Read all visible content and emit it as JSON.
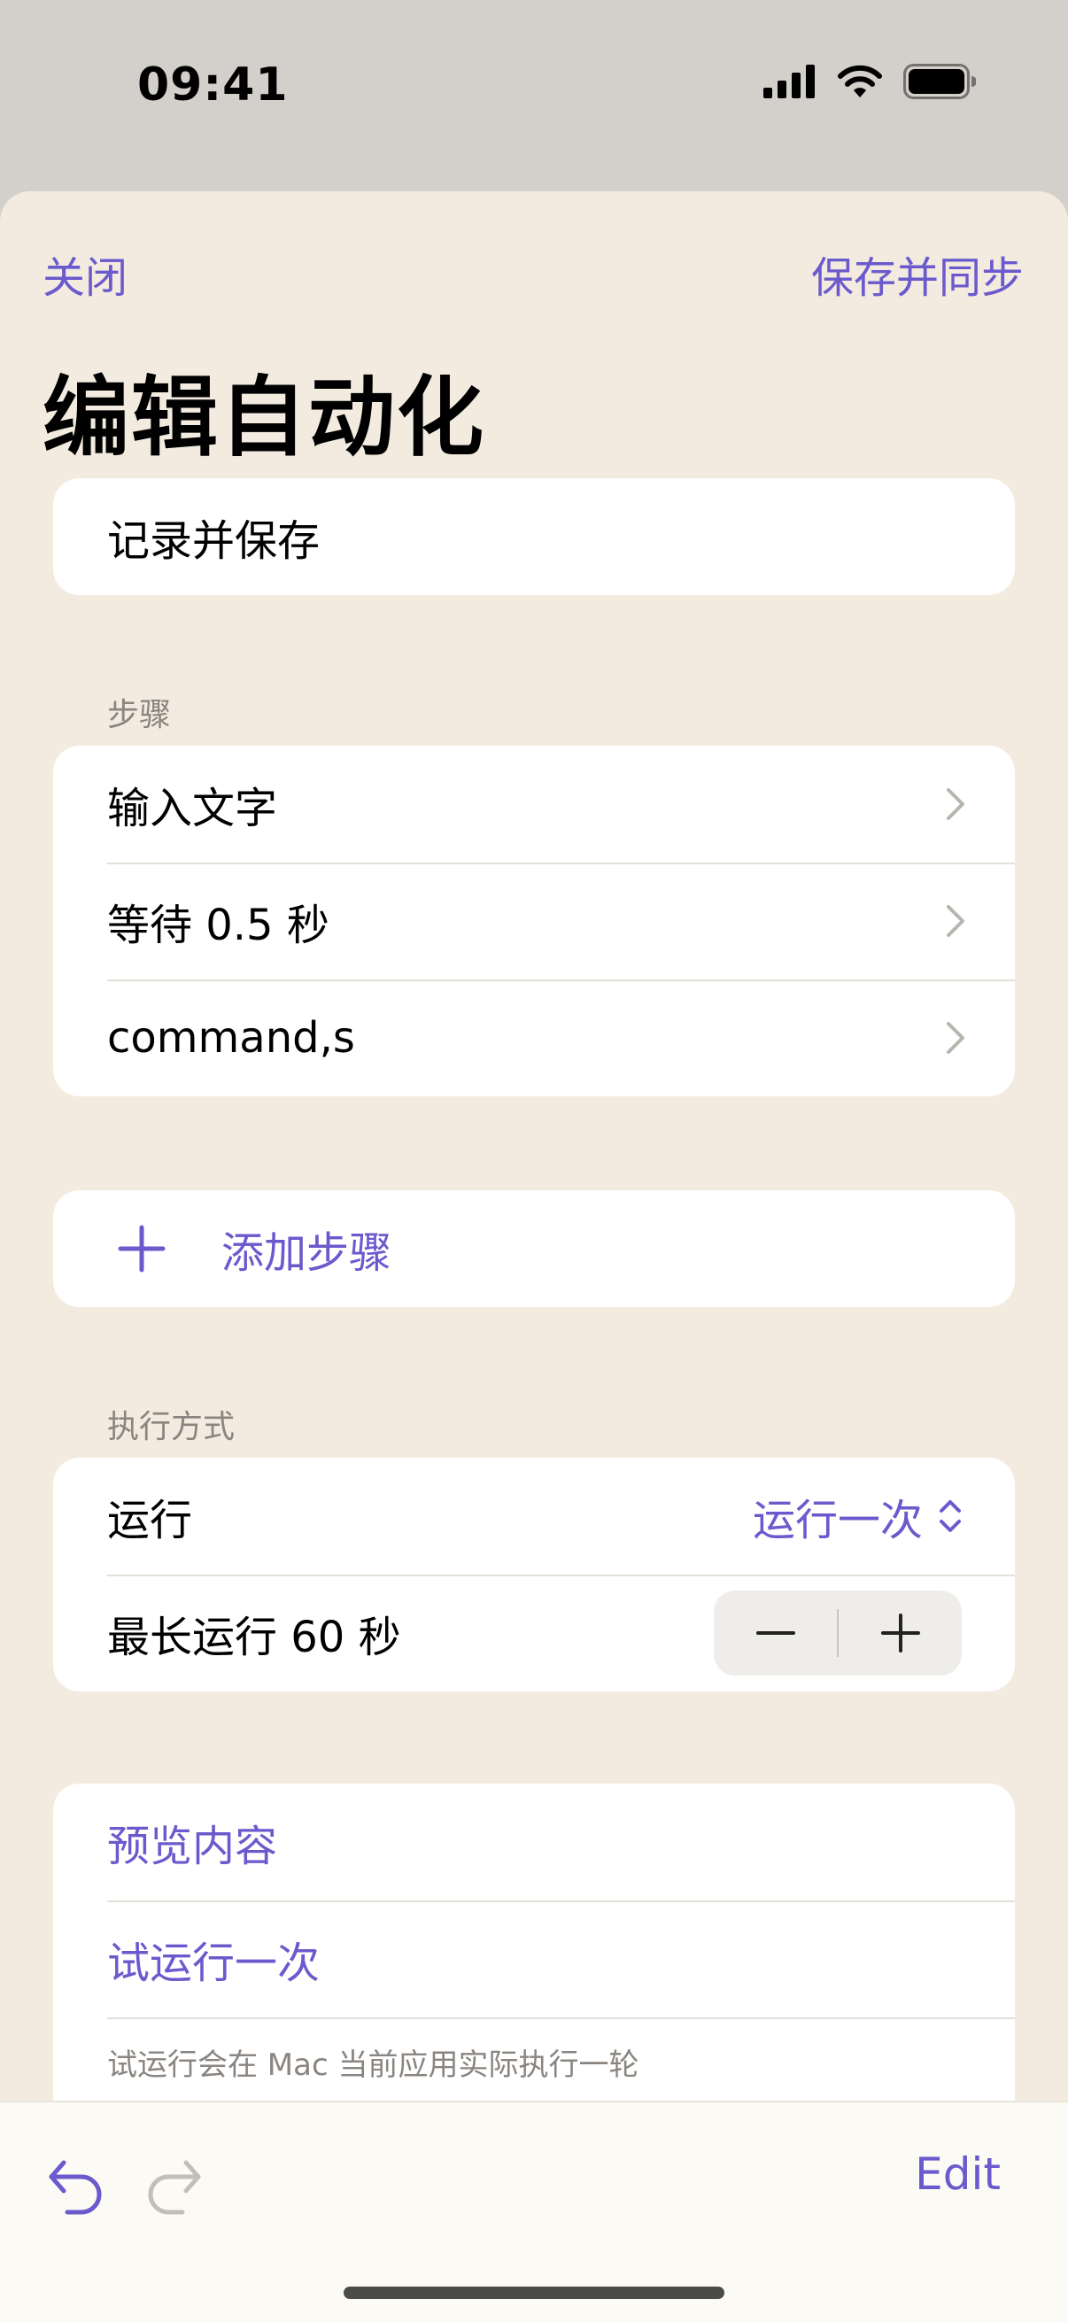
{
  "status_bar": {
    "time": "09:41"
  },
  "nav": {
    "close_label": "关闭",
    "save_label": "保存并同步"
  },
  "title": "编辑自动化",
  "name_field": {
    "value": "记录并保存"
  },
  "steps_section": {
    "label": "步骤",
    "items": [
      {
        "label": "输入文字"
      },
      {
        "label": "等待 0.5 秒"
      },
      {
        "label": "command,s"
      }
    ]
  },
  "add_step": {
    "label": "添加步骤"
  },
  "execution_section": {
    "label": "执行方式",
    "run_label": "运行",
    "run_value": "运行一次",
    "max_run_label": "最长运行 60 秒"
  },
  "actions": {
    "preview_label": "预览内容",
    "test_run_label": "试运行一次",
    "footnote": "试运行会在 Mac 当前应用实际执行一轮"
  },
  "toolbar": {
    "edit_label": "Edit"
  },
  "colors": {
    "accent": "#6a5acd",
    "sheet_bg": "#f3ebdf",
    "card_bg": "#ffffff"
  }
}
